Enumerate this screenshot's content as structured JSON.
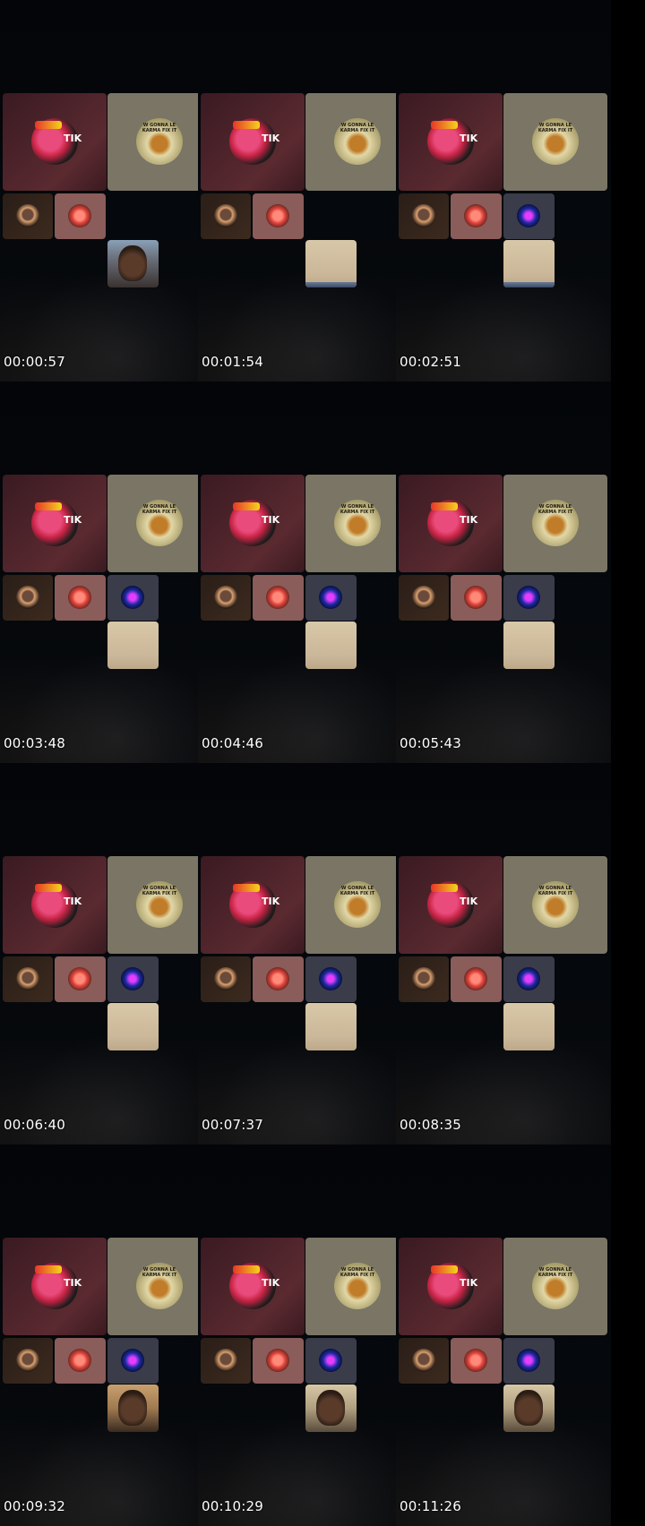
{
  "host_tag": "TIK",
  "cohost_caption": "W GONNA LE KARMA FIX IT",
  "colors": {
    "background": "#000000",
    "timestamp_text": "#ffffff",
    "host_tile": "#4a2228",
    "cohost_tile": "#7a7565"
  },
  "frames": [
    {
      "timestamp": "00:00:57",
      "guest3": false,
      "guest4": "face-a"
    },
    {
      "timestamp": "00:01:54",
      "guest3": false,
      "guest4": "sand-edge"
    },
    {
      "timestamp": "00:02:51",
      "guest3": true,
      "guest4": "sand-edge"
    },
    {
      "timestamp": "00:03:48",
      "guest3": true,
      "guest4": "sand"
    },
    {
      "timestamp": "00:04:46",
      "guest3": true,
      "guest4": "sand"
    },
    {
      "timestamp": "00:05:43",
      "guest3": true,
      "guest4": "sand"
    },
    {
      "timestamp": "00:06:40",
      "guest3": true,
      "guest4": "sand"
    },
    {
      "timestamp": "00:07:37",
      "guest3": true,
      "guest4": "sand"
    },
    {
      "timestamp": "00:08:35",
      "guest3": true,
      "guest4": "sand"
    },
    {
      "timestamp": "00:09:32",
      "guest3": true,
      "guest4": "face-b"
    },
    {
      "timestamp": "00:10:29",
      "guest3": true,
      "guest4": "face-c"
    },
    {
      "timestamp": "00:11:26",
      "guest3": true,
      "guest4": "face-c"
    }
  ]
}
